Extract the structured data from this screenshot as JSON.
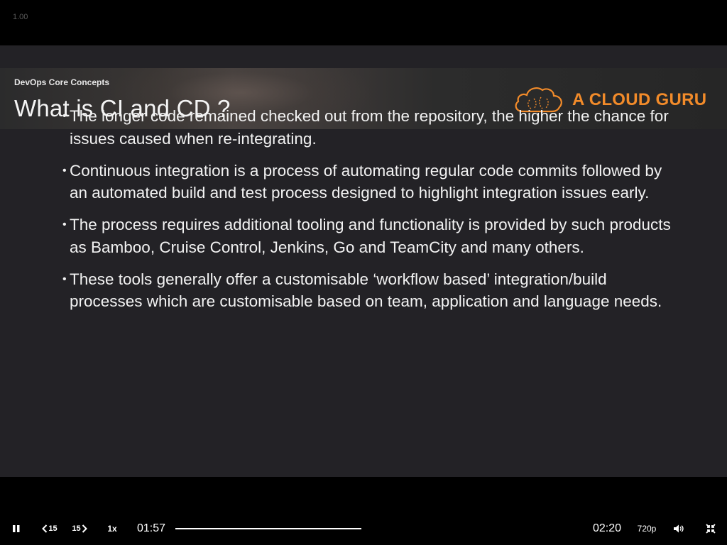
{
  "overlay": {
    "speed_indicator": "1.00"
  },
  "slide": {
    "section": "DevOps Core Concepts",
    "title": "What is CI and CD ?",
    "brand": "A CLOUD GURU",
    "bullets": [
      "The longer code remained checked out from the repository, the higher the chance for issues caused when re-integrating.",
      "Continuous integration is a process of automating regular code commits followed by an automated build and test process designed to highlight integration issues early.",
      "The process requires additional tooling and functionality is provided by such products as Bamboo, Cruise Control, Jenkins, Go and TeamCity and many others.",
      "These tools generally offer a customisable ‘workflow based’ integration/build processes which are customisable based on team, application and language needs."
    ]
  },
  "controls": {
    "play_pause_icon": "pause-icon",
    "rewind_label": "15",
    "forward_label": "15",
    "speed_label": "1x",
    "current_time": "01:57",
    "duration": "02:20",
    "quality": "720p",
    "volume_icon": "volume-icon",
    "fullscreen_icon": "exit-fullscreen-icon",
    "progress_fraction": 1.0
  },
  "colors": {
    "brand_orange": "#f28b2a",
    "slide_background": "#232226",
    "progress_played": "#ffffff",
    "progress_track": "#8a8a8a"
  }
}
